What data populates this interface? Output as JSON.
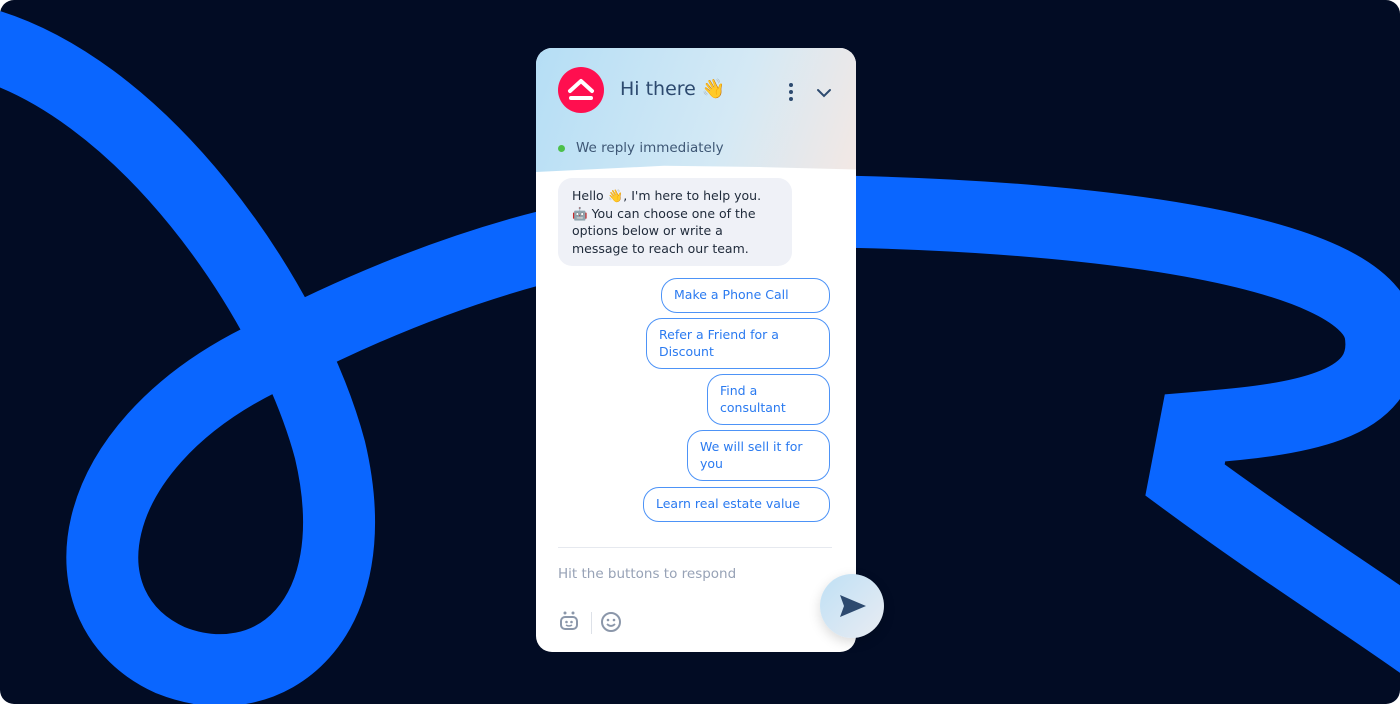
{
  "colors": {
    "background": "#020c24",
    "stroke": "#0a66ff",
    "brand": "#ff0f4f",
    "accent": "#2a7af0"
  },
  "header": {
    "title": "Hi there",
    "title_emoji": "👋",
    "status": "We reply immediately",
    "logo_icon": "house-chevron-logo",
    "menu_icon": "kebab-icon",
    "collapse_icon": "chevron-down-icon"
  },
  "message": {
    "text_1": "Hello ",
    "emoji_1": "👋",
    "text_2": ", I'm here to help you. ",
    "emoji_2": "🤖",
    "text_3": "You can choose one of the options below or write a message to reach our team."
  },
  "options": [
    "Make a Phone Call",
    "Refer a Friend for a Discount",
    "Find a consultant",
    "We will sell it for you",
    "Learn real estate value"
  ],
  "composer": {
    "placeholder": "Hit the buttons to respond",
    "bot_icon": "bot-icon",
    "emoji_icon": "smiley-icon",
    "send_icon": "send-icon"
  }
}
